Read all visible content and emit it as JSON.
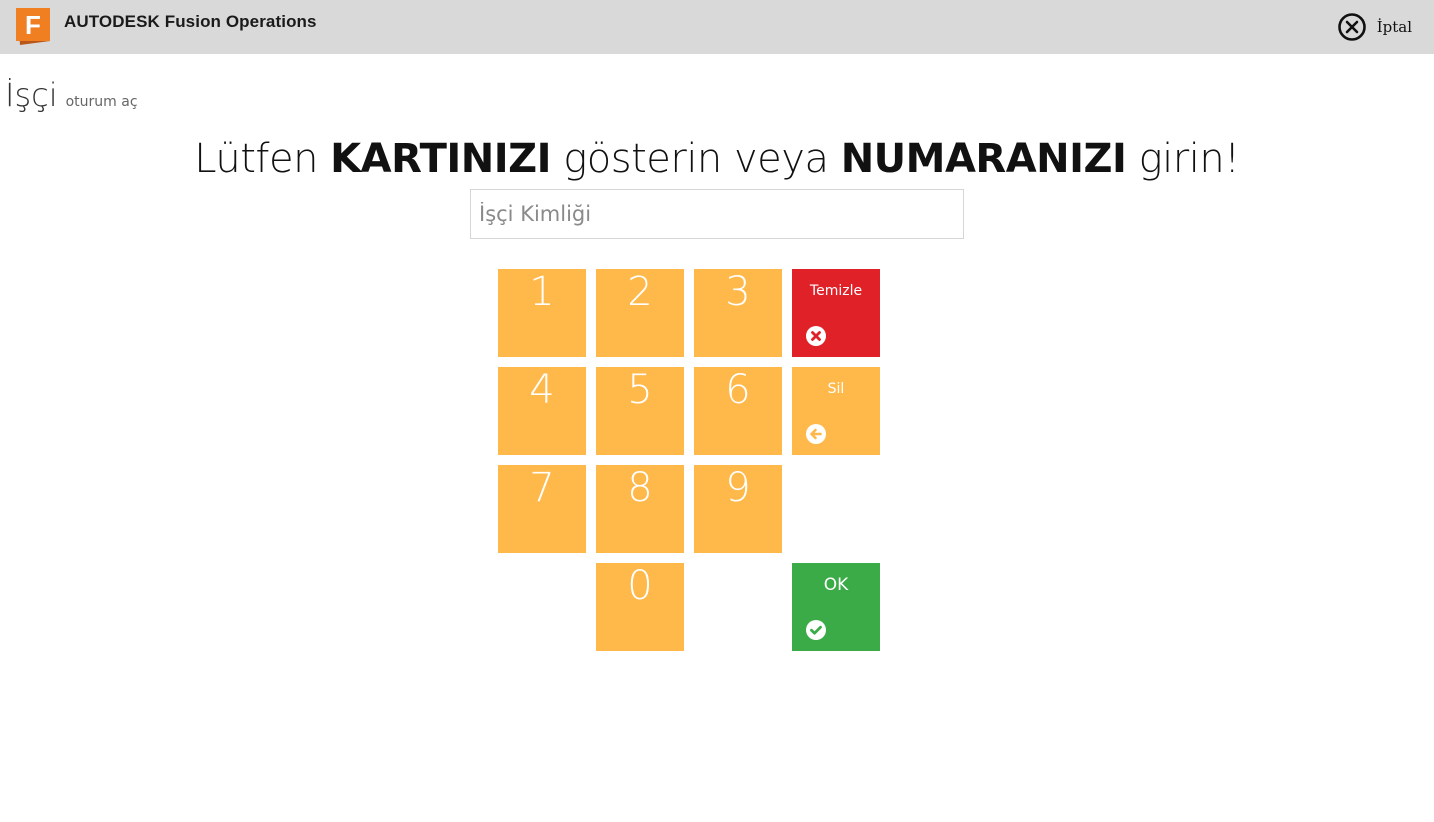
{
  "header": {
    "brand_company": "AUTODESK",
    "brand_product": "Fusion Operations",
    "logo_letter": "F",
    "cancel_label": "İptal"
  },
  "page": {
    "title": "İşçi",
    "subtitle": "oturum aç"
  },
  "prompt": {
    "part1": "Lütfen ",
    "bold1": "KARTINIZI",
    "part2": " gösterin veya ",
    "bold2": "NUMARANIZI",
    "part3": " girin!"
  },
  "input": {
    "value": "",
    "placeholder": "İşçi Kimliği"
  },
  "keypad": {
    "digits": [
      "1",
      "2",
      "3",
      "4",
      "5",
      "6",
      "7",
      "8",
      "9",
      "0"
    ],
    "clear_label": "Temizle",
    "delete_label": "Sil",
    "ok_label": "OK"
  },
  "colors": {
    "topbar": "#d9d9d9",
    "logo_orange": "#f07f22",
    "key_orange": "#ffb84a",
    "clear_red": "#e02128",
    "ok_green": "#3aab47"
  },
  "icons": {
    "logo": "fusion-logo-icon",
    "cancel": "close-circle-icon",
    "clear": "x-circle-icon",
    "delete": "arrow-left-circle-icon",
    "ok": "check-circle-icon"
  }
}
